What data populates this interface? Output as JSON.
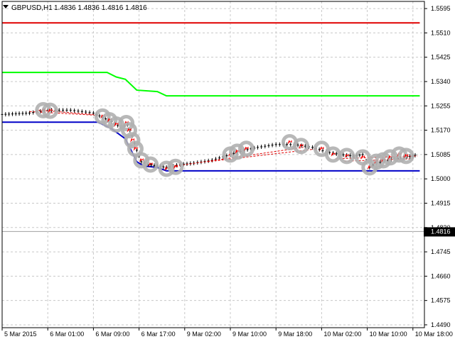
{
  "header": {
    "symbol": "GBPUSD,H1",
    "ohlc": "1.4836 1.4836 1.4816 1.4816"
  },
  "current_price_label": "1.4816",
  "colors": {
    "grid": "#c8c8c8",
    "axis": "#000000",
    "red_line": "#e00000",
    "green_line": "#00ff00",
    "blue_line": "#0000c8",
    "candles": "#000000",
    "marker_halo": "#b0b0b0",
    "marker_arrow": "#ff0000",
    "trendline": "#e00000",
    "price_box": "#000000",
    "price_text": "#ffffff"
  },
  "chart_data": {
    "type": "line",
    "title": "GBPUSD,H1",
    "x": [
      "5 Mar 2015",
      "6 Mar 01:00",
      "6 Mar 09:00",
      "6 Mar 17:00",
      "9 Mar 02:00",
      "9 Mar 10:00",
      "9 Mar 18:00",
      "10 Mar 02:00",
      "10 Mar 10:00",
      "10 Mar 18:00"
    ],
    "y_ticks": [
      "1.5595",
      "1.5510",
      "1.5425",
      "1.5340",
      "1.5255",
      "1.5170",
      "1.5085",
      "1.5000",
      "1.4915",
      "1.4830",
      "1.4745",
      "1.4660",
      "1.4575",
      "1.4490"
    ],
    "ylim": [
      1.448,
      1.562
    ],
    "grid": true,
    "series": [
      {
        "name": "",
        "color": "red",
        "points": [
          [
            0,
            1.5545
          ],
          [
            9.15,
            1.5545
          ]
        ]
      },
      {
        "name": "",
        "color": "green",
        "points": [
          [
            0,
            1.5372
          ],
          [
            2.3,
            1.5372
          ],
          [
            2.5,
            1.5356
          ],
          [
            2.7,
            1.5348
          ],
          [
            2.95,
            1.531
          ],
          [
            3.4,
            1.5305
          ],
          [
            3.6,
            1.529
          ],
          [
            9.15,
            1.529
          ]
        ]
      },
      {
        "name": "",
        "color": "blue",
        "points": [
          [
            0,
            1.5198
          ],
          [
            2.1,
            1.5198
          ],
          [
            2.4,
            1.5175
          ],
          [
            2.7,
            1.514
          ],
          [
            2.95,
            1.506
          ],
          [
            3.1,
            1.5045
          ],
          [
            3.4,
            1.504
          ],
          [
            3.6,
            1.5028
          ],
          [
            9.15,
            1.5028
          ]
        ]
      }
    ],
    "price_path": [
      [
        0,
        1.5225
      ],
      [
        0.6,
        1.523
      ],
      [
        1.0,
        1.524
      ],
      [
        1.5,
        1.524
      ],
      [
        2.0,
        1.523
      ],
      [
        2.2,
        1.5215
      ],
      [
        2.4,
        1.52
      ],
      [
        2.6,
        1.518
      ],
      [
        2.75,
        1.519
      ],
      [
        2.85,
        1.515
      ],
      [
        2.95,
        1.51
      ],
      [
        3.05,
        1.506
      ],
      [
        3.2,
        1.505
      ],
      [
        3.4,
        1.5045
      ],
      [
        3.6,
        1.504
      ],
      [
        3.9,
        1.505
      ],
      [
        4.2,
        1.5055
      ],
      [
        4.6,
        1.5065
      ],
      [
        5.0,
        1.5085
      ],
      [
        5.3,
        1.51
      ],
      [
        5.6,
        1.511
      ],
      [
        6.0,
        1.512
      ],
      [
        6.4,
        1.512
      ],
      [
        6.8,
        1.511
      ],
      [
        7.1,
        1.5095
      ],
      [
        7.4,
        1.5085
      ],
      [
        7.7,
        1.508
      ],
      [
        7.9,
        1.5085
      ],
      [
        8.05,
        1.504
      ],
      [
        8.2,
        1.5055
      ],
      [
        8.45,
        1.5065
      ],
      [
        8.6,
        1.507
      ],
      [
        8.8,
        1.5075
      ],
      [
        9.0,
        1.508
      ],
      [
        9.1,
        1.5085
      ]
    ],
    "markers": [
      [
        0.9,
        1.524
      ],
      [
        1.05,
        1.5238
      ],
      [
        2.2,
        1.5218
      ],
      [
        2.35,
        1.5205
      ],
      [
        2.5,
        1.519
      ],
      [
        2.72,
        1.5195
      ],
      [
        2.78,
        1.517
      ],
      [
        2.85,
        1.5135
      ],
      [
        2.92,
        1.5105
      ],
      [
        3.05,
        1.5065
      ],
      [
        3.25,
        1.505
      ],
      [
        3.6,
        1.5035
      ],
      [
        3.8,
        1.5042
      ],
      [
        5.0,
        1.5085
      ],
      [
        5.15,
        1.5095
      ],
      [
        5.35,
        1.5105
      ],
      [
        6.3,
        1.5128
      ],
      [
        6.55,
        1.5115
      ],
      [
        7.0,
        1.5105
      ],
      [
        7.25,
        1.5085
      ],
      [
        7.55,
        1.508
      ],
      [
        7.9,
        1.5075
      ],
      [
        8.05,
        1.504
      ],
      [
        8.2,
        1.506
      ],
      [
        8.35,
        1.5065
      ],
      [
        8.5,
        1.5075
      ],
      [
        8.7,
        1.5085
      ],
      [
        8.85,
        1.508
      ]
    ],
    "trendlines": [
      [
        [
          0.6,
          1.5235
        ],
        [
          2.1,
          1.5222
        ]
      ],
      [
        [
          0.8,
          1.524
        ],
        [
          2.0,
          1.5225
        ]
      ],
      [
        [
          3.8,
          1.5045
        ],
        [
          6.6,
          1.511
        ]
      ],
      [
        [
          4.5,
          1.506
        ],
        [
          6.9,
          1.5105
        ]
      ],
      [
        [
          7.3,
          1.507
        ],
        [
          9.1,
          1.508
        ]
      ],
      [
        [
          7.5,
          1.5062
        ],
        [
          9.0,
          1.507
        ]
      ]
    ]
  }
}
